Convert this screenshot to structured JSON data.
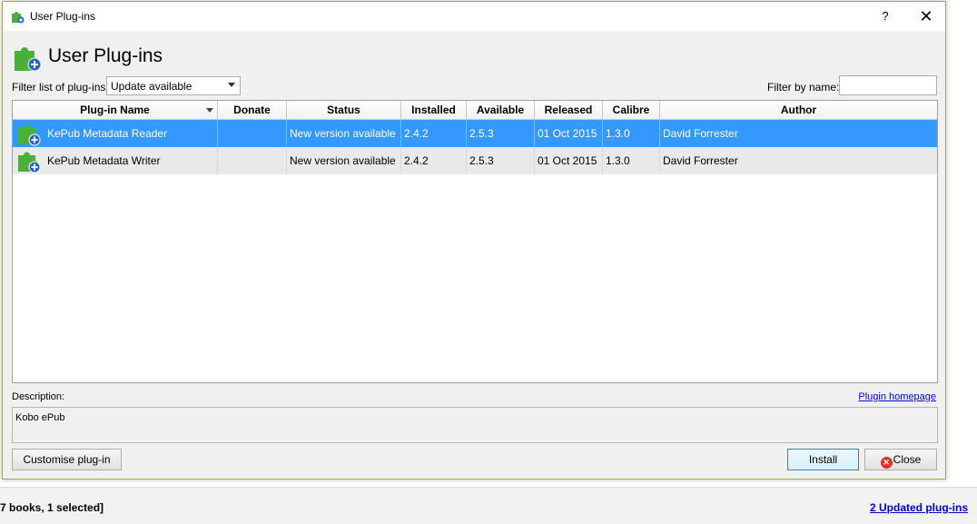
{
  "window": {
    "title": "User Plug-ins",
    "help_glyph": "?",
    "close_glyph": "✕"
  },
  "header": {
    "title": "User Plug-ins"
  },
  "filters": {
    "list_label": "Filter list of plug-ins:",
    "list_selected": "Update available",
    "name_label": "Filter by name:",
    "name_value": ""
  },
  "table": {
    "columns": [
      "Plug-in Name",
      "Donate",
      "Status",
      "Installed",
      "Available",
      "Released",
      "Calibre",
      "Author"
    ],
    "rows": [
      {
        "name": "KePub Metadata Reader",
        "donate": "",
        "status": "New version available",
        "installed": "2.4.2",
        "available": "2.5.3",
        "released": "01 Oct 2015",
        "calibre": "1.3.0",
        "author": "David Forrester"
      },
      {
        "name": "KePub Metadata Writer",
        "donate": "",
        "status": "New version available",
        "installed": "2.4.2",
        "available": "2.5.3",
        "released": "01 Oct 2015",
        "calibre": "1.3.0",
        "author": "David Forrester"
      }
    ]
  },
  "description": {
    "label": "Description:",
    "homepage_link": "Plugin homepage",
    "text": "Kobo ePub"
  },
  "buttons": {
    "customise": "Customise plug-in",
    "install": "Install",
    "close": "Close"
  },
  "app_status": {
    "left": "7 books, 1 selected]",
    "right": "2 Updated plug-ins"
  },
  "colors": {
    "selection": "#3399ff",
    "link": "#0000cc",
    "plugin_icon": "puzzle-green-plus-blue"
  }
}
